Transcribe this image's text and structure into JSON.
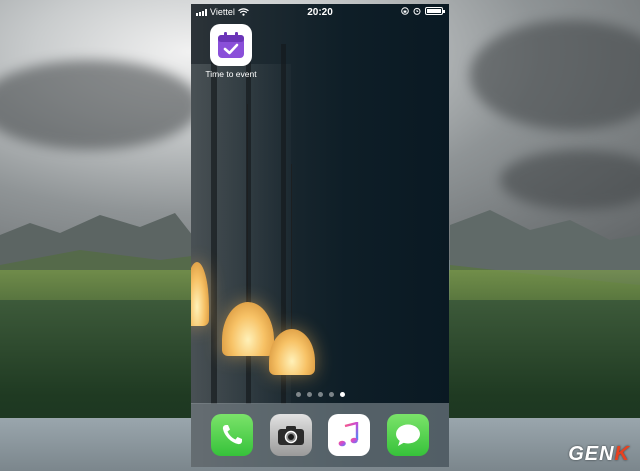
{
  "status_bar": {
    "carrier": "Viettel",
    "time": "20:20"
  },
  "home_screen": {
    "apps": [
      {
        "label": "Time to event",
        "icon": "calendar-check-icon",
        "color": "#8a4fd9"
      }
    ],
    "page_count": 5,
    "active_page": 5
  },
  "dock": {
    "apps": [
      {
        "name": "Phone",
        "icon": "phone-icon"
      },
      {
        "name": "Camera",
        "icon": "camera-icon"
      },
      {
        "name": "Music",
        "icon": "music-note-icon"
      },
      {
        "name": "Messages",
        "icon": "message-bubble-icon"
      }
    ]
  },
  "watermark": {
    "prefix": "GEN",
    "accent": "K",
    "accent_color": "#e8411f"
  },
  "battery_level": 1.0
}
